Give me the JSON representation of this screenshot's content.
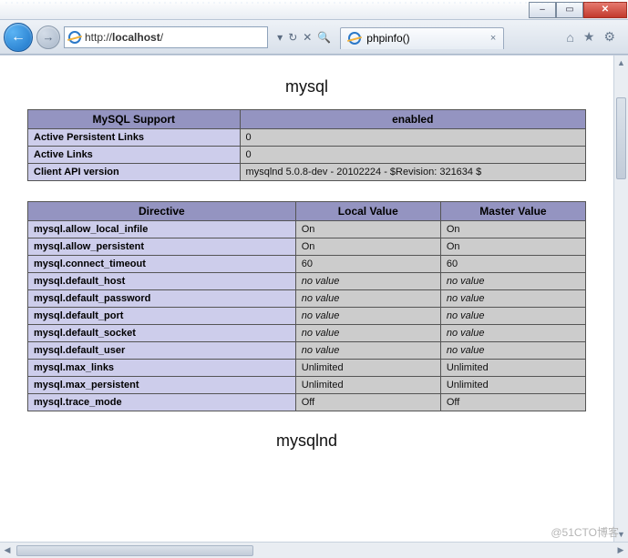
{
  "window": {
    "min_tip": "–",
    "max_tip": "▭",
    "close_tip": "✕"
  },
  "toolbar": {
    "back_glyph": "←",
    "forward_glyph": "→",
    "url_prefix": "http://",
    "url_host": "localhost",
    "url_path": "/",
    "dropdown_glyph": "▾",
    "refresh_glyph": "↻",
    "stop_glyph": "✕",
    "search_glyph": "🔍"
  },
  "tab": {
    "title": "phpinfo()",
    "close_glyph": "×"
  },
  "chrome_icons": {
    "home": "⌂",
    "fav": "★",
    "gear": "⚙"
  },
  "page": {
    "section1_title": "mysql",
    "table1": {
      "header": [
        "MySQL Support",
        "enabled"
      ],
      "rows": [
        {
          "k": "Active Persistent Links",
          "v": "0"
        },
        {
          "k": "Active Links",
          "v": "0"
        },
        {
          "k": "Client API version",
          "v": "mysqlnd 5.0.8-dev - 20102224 - $Revision: 321634 $"
        }
      ]
    },
    "table2": {
      "header": [
        "Directive",
        "Local Value",
        "Master Value"
      ],
      "rows": [
        {
          "k": "mysql.allow_local_infile",
          "l": "On",
          "m": "On",
          "italic": false
        },
        {
          "k": "mysql.allow_persistent",
          "l": "On",
          "m": "On",
          "italic": false
        },
        {
          "k": "mysql.connect_timeout",
          "l": "60",
          "m": "60",
          "italic": false
        },
        {
          "k": "mysql.default_host",
          "l": "no value",
          "m": "no value",
          "italic": true
        },
        {
          "k": "mysql.default_password",
          "l": "no value",
          "m": "no value",
          "italic": true
        },
        {
          "k": "mysql.default_port",
          "l": "no value",
          "m": "no value",
          "italic": true
        },
        {
          "k": "mysql.default_socket",
          "l": "no value",
          "m": "no value",
          "italic": true
        },
        {
          "k": "mysql.default_user",
          "l": "no value",
          "m": "no value",
          "italic": true
        },
        {
          "k": "mysql.max_links",
          "l": "Unlimited",
          "m": "Unlimited",
          "italic": false
        },
        {
          "k": "mysql.max_persistent",
          "l": "Unlimited",
          "m": "Unlimited",
          "italic": false
        },
        {
          "k": "mysql.trace_mode",
          "l": "Off",
          "m": "Off",
          "italic": false
        }
      ]
    },
    "section2_title": "mysqlnd"
  },
  "watermark": "@51CTO博客"
}
